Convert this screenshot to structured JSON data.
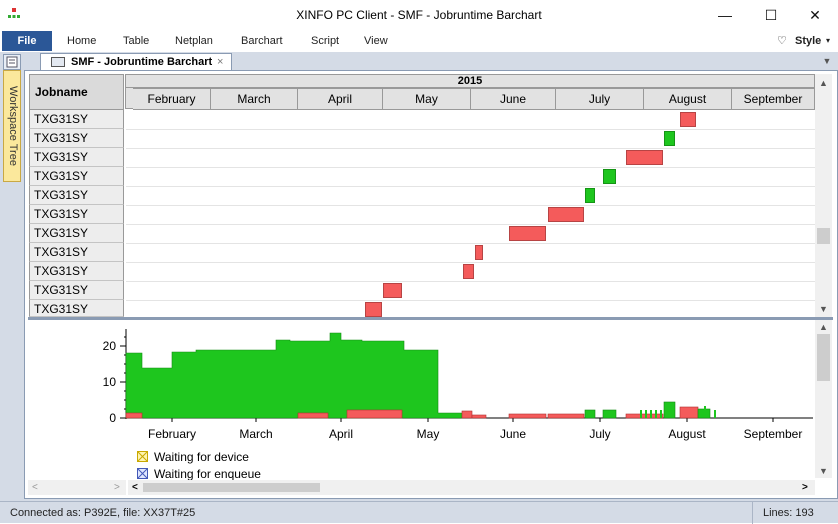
{
  "window": {
    "title": "XINFO PC Client - SMF - Jobruntime Barchart",
    "minimize_glyph": "—",
    "maximize_glyph": "☐",
    "close_glyph": "✕"
  },
  "menu": {
    "file": "File",
    "items": [
      "Home",
      "Table",
      "Netplan",
      "Barchart",
      "Script",
      "View"
    ],
    "style_label": "Style"
  },
  "sidebar": {
    "workspace_tree_label": "Workspace Tree"
  },
  "document_tab": {
    "label": "SMF - Jobruntime Barchart",
    "close_glyph": "×"
  },
  "gantt": {
    "jobname_header": "Jobname",
    "year": "2015",
    "months": [
      "February",
      "March",
      "April",
      "May",
      "June",
      "July",
      "August",
      "September"
    ],
    "rows": [
      "TXG31SY",
      "TXG31SY",
      "TXG31SY",
      "TXG31SY",
      "TXG31SY",
      "TXG31SY",
      "TXG31SY",
      "TXG31SY",
      "TXG31SY",
      "TXG31SY",
      "TXG31SY"
    ],
    "colors": {
      "red": "#f45b5b",
      "green": "#1ec61e"
    }
  },
  "histogram": {
    "y_ticks": [
      "20",
      "10",
      "0"
    ],
    "x_ticks": [
      "February",
      "March",
      "April",
      "May",
      "June",
      "July",
      "August",
      "September"
    ]
  },
  "legend": [
    {
      "icon": "crossed-square-yellow-icon",
      "label": "Waiting for device"
    },
    {
      "icon": "crossed-square-blue-icon",
      "label": "Waiting for enqueue"
    }
  ],
  "statusbar": {
    "connection": "Connected as: P392E, file: XX37T#25",
    "lines": "Lines: 193"
  }
}
